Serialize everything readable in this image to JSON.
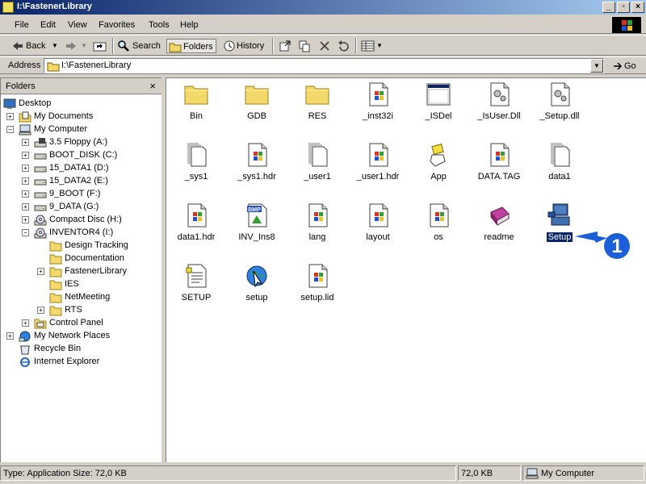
{
  "window": {
    "title": "I:\\FastenerLibrary",
    "controls": {
      "minimize": "_",
      "maximize": "▫",
      "close": "×"
    }
  },
  "menu": [
    "File",
    "Edit",
    "View",
    "Favorites",
    "Tools",
    "Help"
  ],
  "toolbar": {
    "back": "Back",
    "search": "Search",
    "folders": "Folders",
    "history": "History"
  },
  "address": {
    "label": "Address",
    "value": "I:\\FastenerLibrary",
    "go": "Go"
  },
  "folders_pane": {
    "title": "Folders",
    "close": "×",
    "tree": [
      {
        "label": "Desktop",
        "icon": "desktop-icon"
      },
      {
        "label": "My Documents",
        "icon": "my-documents-icon"
      },
      {
        "label": "My Computer",
        "icon": "my-computer-icon"
      },
      {
        "label": "3.5 Floppy (A:)",
        "icon": "floppy-drive-icon"
      },
      {
        "label": "BOOT_DISK (C:)",
        "icon": "hard-drive-icon"
      },
      {
        "label": "15_DATA1 (D:)",
        "icon": "hard-drive-icon"
      },
      {
        "label": "15_DATA2 (E:)",
        "icon": "hard-drive-icon"
      },
      {
        "label": "9_BOOT (F:)",
        "icon": "hard-drive-icon"
      },
      {
        "label": "9_DATA (G:)",
        "icon": "hard-drive-icon"
      },
      {
        "label": "Compact Disc (H:)",
        "icon": "cd-drive-icon"
      },
      {
        "label": "INVENTOR4 (I:)",
        "icon": "cd-drive-icon"
      },
      {
        "label": "Design Tracking",
        "icon": "folder-icon"
      },
      {
        "label": "Documentation",
        "icon": "folder-icon"
      },
      {
        "label": "FastenerLibrary",
        "icon": "folder-icon"
      },
      {
        "label": "IES",
        "icon": "folder-icon"
      },
      {
        "label": "NetMeeting",
        "icon": "folder-icon"
      },
      {
        "label": "RTS",
        "icon": "folder-icon"
      },
      {
        "label": "Control Panel",
        "icon": "control-panel-icon"
      },
      {
        "label": "My Network Places",
        "icon": "network-places-icon"
      },
      {
        "label": "Recycle Bin",
        "icon": "recycle-bin-icon"
      },
      {
        "label": "Internet Explorer",
        "icon": "internet-explorer-icon"
      }
    ]
  },
  "files": [
    {
      "label": "Bin",
      "icon": "folder-icon"
    },
    {
      "label": "GDB",
      "icon": "folder-icon"
    },
    {
      "label": "RES",
      "icon": "folder-icon"
    },
    {
      "label": "_inst32i",
      "icon": "windows-file-icon"
    },
    {
      "label": "_ISDel",
      "icon": "application-window-icon"
    },
    {
      "label": "_IsUser.Dll",
      "icon": "dll-file-icon"
    },
    {
      "label": "_Setup.dll",
      "icon": "dll-file-icon"
    },
    {
      "label": "_sys1",
      "icon": "blank-file-icon"
    },
    {
      "label": "_sys1.hdr",
      "icon": "windows-file-icon"
    },
    {
      "label": "_user1",
      "icon": "blank-file-icon"
    },
    {
      "label": "_user1.hdr",
      "icon": "windows-file-icon"
    },
    {
      "label": "App",
      "icon": "app-hand-icon"
    },
    {
      "label": "DATA.TAG",
      "icon": "windows-file-icon"
    },
    {
      "label": "data1",
      "icon": "blank-file-icon"
    },
    {
      "label": "data1.hdr",
      "icon": "windows-file-icon"
    },
    {
      "label": "INV_Ins8",
      "icon": "bmp-file-icon"
    },
    {
      "label": "lang",
      "icon": "windows-file-icon"
    },
    {
      "label": "layout",
      "icon": "windows-file-icon"
    },
    {
      "label": "os",
      "icon": "windows-file-icon"
    },
    {
      "label": "readme",
      "icon": "readme-book-icon"
    },
    {
      "label": "Setup",
      "icon": "setup-computer-icon",
      "selected": true
    },
    {
      "label": "SETUP",
      "icon": "text-file-icon"
    },
    {
      "label": "setup",
      "icon": "setup-globe-icon"
    },
    {
      "label": "setup.lid",
      "icon": "windows-file-icon"
    }
  ],
  "callout": {
    "number": "1"
  },
  "status": {
    "info": "Type: Application Size: 72,0 KB",
    "size": "72,0 KB",
    "zone": "My Computer"
  },
  "colors": {
    "titlebar_start": "#0a246a",
    "titlebar_end": "#a6caf0",
    "selection": "#0a246a",
    "callout": "#1a5fd8"
  }
}
